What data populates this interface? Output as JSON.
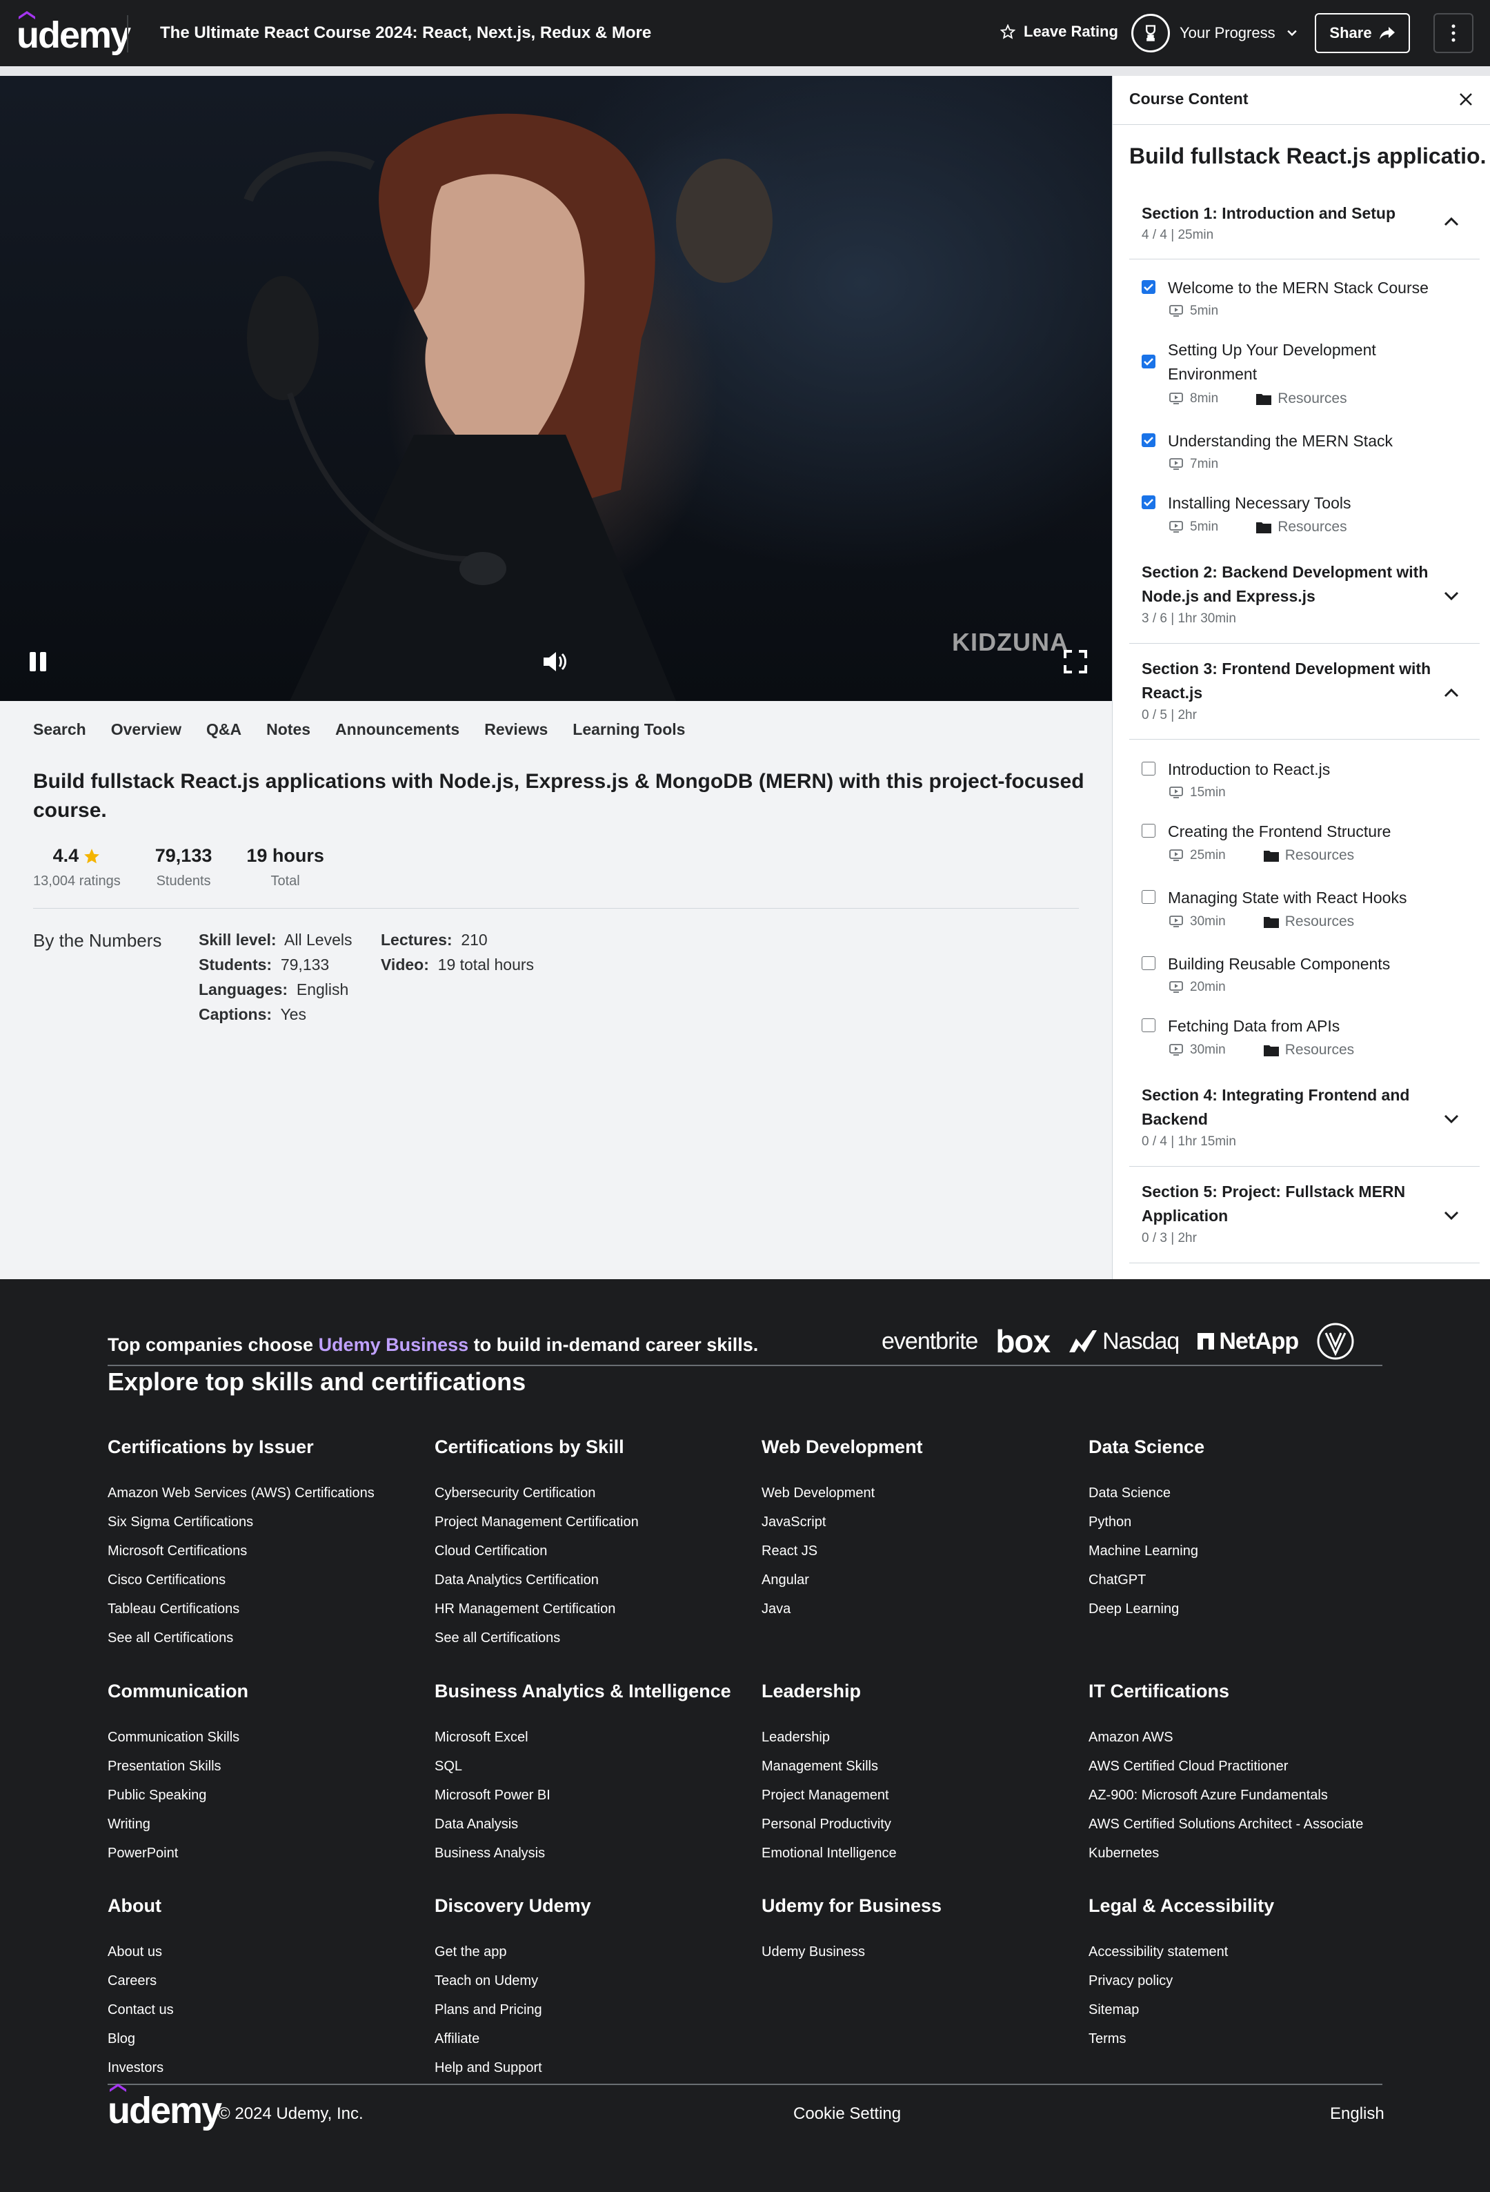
{
  "header": {
    "logo": "udemy",
    "course_title": "The Ultimate React Course 2024: React, Next.js, Redux & More",
    "leave_rating": "Leave Rating",
    "progress": "Your Progress",
    "share": "Share"
  },
  "video": {
    "watermark": "KIDZUNA"
  },
  "tabs": [
    "Search",
    "Overview",
    "Q&A",
    "Notes",
    "Announcements",
    "Reviews",
    "Learning Tools"
  ],
  "overview": {
    "heading": "Build fullstack React.js applications with Node.js, Express.js & MongoDB (MERN) with this project-focused course.",
    "rating": "4.4",
    "rating_label": "13,004 ratings",
    "students": "79,133",
    "students_label": "Students",
    "hours": "19 hours",
    "hours_label": "Total",
    "by_numbers": "By the Numbers",
    "col1": [
      {
        "k": "Skill level:",
        "v": "All Levels"
      },
      {
        "k": "Students:",
        "v": "79,133"
      },
      {
        "k": "Languages:",
        "v": "English"
      },
      {
        "k": "Captions:",
        "v": "Yes"
      }
    ],
    "col2": [
      {
        "k": "Lectures:",
        "v": "210"
      },
      {
        "k": "Video:",
        "v": "19 total hours"
      }
    ]
  },
  "sidebar": {
    "header": "Course Content",
    "title": "Build fullstack React.js applicatio...",
    "resources_label": "Resources",
    "sections": [
      {
        "title": "Section 1: Introduction and Setup",
        "sub": "4 / 4 | 25min",
        "expanded": true,
        "items": [
          {
            "title": "Welcome to the MERN Stack Course",
            "duration": "5min",
            "done": true,
            "resources": false
          },
          {
            "title": "Setting Up Your Development Environment",
            "duration": "8min",
            "done": true,
            "resources": true
          },
          {
            "title": "Understanding the MERN Stack",
            "duration": "7min",
            "done": true,
            "resources": false
          },
          {
            "title": "Installing Necessary Tools",
            "duration": "5min",
            "done": true,
            "resources": true
          }
        ]
      },
      {
        "title": "Section 2: Backend Development with Node.js and Express.js",
        "sub": "3 / 6 | 1hr 30min",
        "expanded": false
      },
      {
        "title": "Section 3: Frontend Development with React.js",
        "sub": "0 / 5 | 2hr",
        "expanded": true,
        "items": [
          {
            "title": "Introduction to React.js",
            "duration": "15min",
            "done": false,
            "resources": false
          },
          {
            "title": "Creating the Frontend Structure",
            "duration": "25min",
            "done": false,
            "resources": true
          },
          {
            "title": "Managing State with React Hooks",
            "duration": "30min",
            "done": false,
            "resources": true
          },
          {
            "title": "Building Reusable Components",
            "duration": "20min",
            "done": false,
            "resources": false
          },
          {
            "title": "Fetching Data from APIs",
            "duration": "30min",
            "done": false,
            "resources": true
          }
        ]
      },
      {
        "title": "Section 4: Integrating Frontend and Backend",
        "sub": "0 / 4 | 1hr 15min",
        "expanded": false
      },
      {
        "title": "Section 5: Project: Fullstack MERN Application",
        "sub": "0 / 3 | 2hr",
        "expanded": false
      }
    ]
  },
  "footer": {
    "tagline_pre": "Top companies choose ",
    "tagline_brand": "Udemy Business",
    "tagline_post": " to build in-demand career skills.",
    "brands": [
      "eventbrite",
      "box",
      "Nasdaq",
      "NetApp"
    ],
    "explore": "Explore top skills and certifications",
    "columns": [
      {
        "title": "Certifications by Issuer",
        "links": [
          "Amazon Web Services (AWS) Certifications",
          "Six Sigma Certifications",
          "Microsoft Certifications",
          "Cisco Certifications",
          "Tableau Certifications",
          "See all Certifications"
        ]
      },
      {
        "title": "Certifications by Skill",
        "links": [
          "Cybersecurity Certification",
          "Project Management Certification",
          "Cloud Certification",
          "Data Analytics Certification",
          "HR Management Certification",
          "See all Certifications"
        ]
      },
      {
        "title": "Web Development",
        "links": [
          "Web Development",
          "JavaScript",
          "React JS",
          "Angular",
          "Java"
        ]
      },
      {
        "title": "Data Science",
        "links": [
          "Data Science",
          "Python",
          "Machine Learning",
          "ChatGPT",
          "Deep Learning"
        ]
      },
      {
        "title": "Communication",
        "links": [
          "Communication Skills",
          "Presentation Skills",
          "Public Speaking",
          "Writing",
          "PowerPoint"
        ]
      },
      {
        "title": "Business Analytics & Intelligence",
        "links": [
          "Microsoft Excel",
          "SQL",
          "Microsoft Power BI",
          "Data Analysis",
          "Business Analysis"
        ]
      },
      {
        "title": "Leadership",
        "links": [
          "Leadership",
          "Management Skills",
          "Project Management",
          "Personal Productivity",
          "Emotional Intelligence"
        ]
      },
      {
        "title": "IT Certifications",
        "links": [
          "Amazon AWS",
          "AWS Certified Cloud Practitioner",
          "AZ-900: Microsoft Azure Fundamentals",
          "AWS Certified Solutions Architect - Associate",
          "Kubernetes"
        ]
      },
      {
        "title": "About",
        "links": [
          "About us",
          "Careers",
          "Contact us",
          "Blog",
          "Investors"
        ]
      },
      {
        "title": "Discovery Udemy",
        "links": [
          "Get the app",
          "Teach on Udemy",
          "Plans and Pricing",
          "Affiliate",
          "Help and Support"
        ]
      },
      {
        "title": "Udemy for Business",
        "links": [
          "Udemy Business"
        ]
      },
      {
        "title": "Legal & Accessibility",
        "links": [
          "Accessibility statement",
          "Privacy policy",
          "Sitemap",
          "Terms"
        ]
      }
    ],
    "copyright": "© 2024 Udemy, Inc.",
    "cookie": "Cookie Setting",
    "language": "English"
  },
  "colors": {
    "header_bg": "#1c1d1f",
    "accent_purple": "#a435f0",
    "checkbox": "#1a73e8",
    "star": "#f4b400",
    "brand_link": "#c0a1ff"
  },
  "icons": {
    "star": "star-icon",
    "trophy": "trophy-icon",
    "share": "share-icon",
    "more": "kebab-icon",
    "close": "close-icon",
    "pause": "pause-icon",
    "volume": "volume-icon",
    "fullscreen": "fullscreen-icon"
  }
}
